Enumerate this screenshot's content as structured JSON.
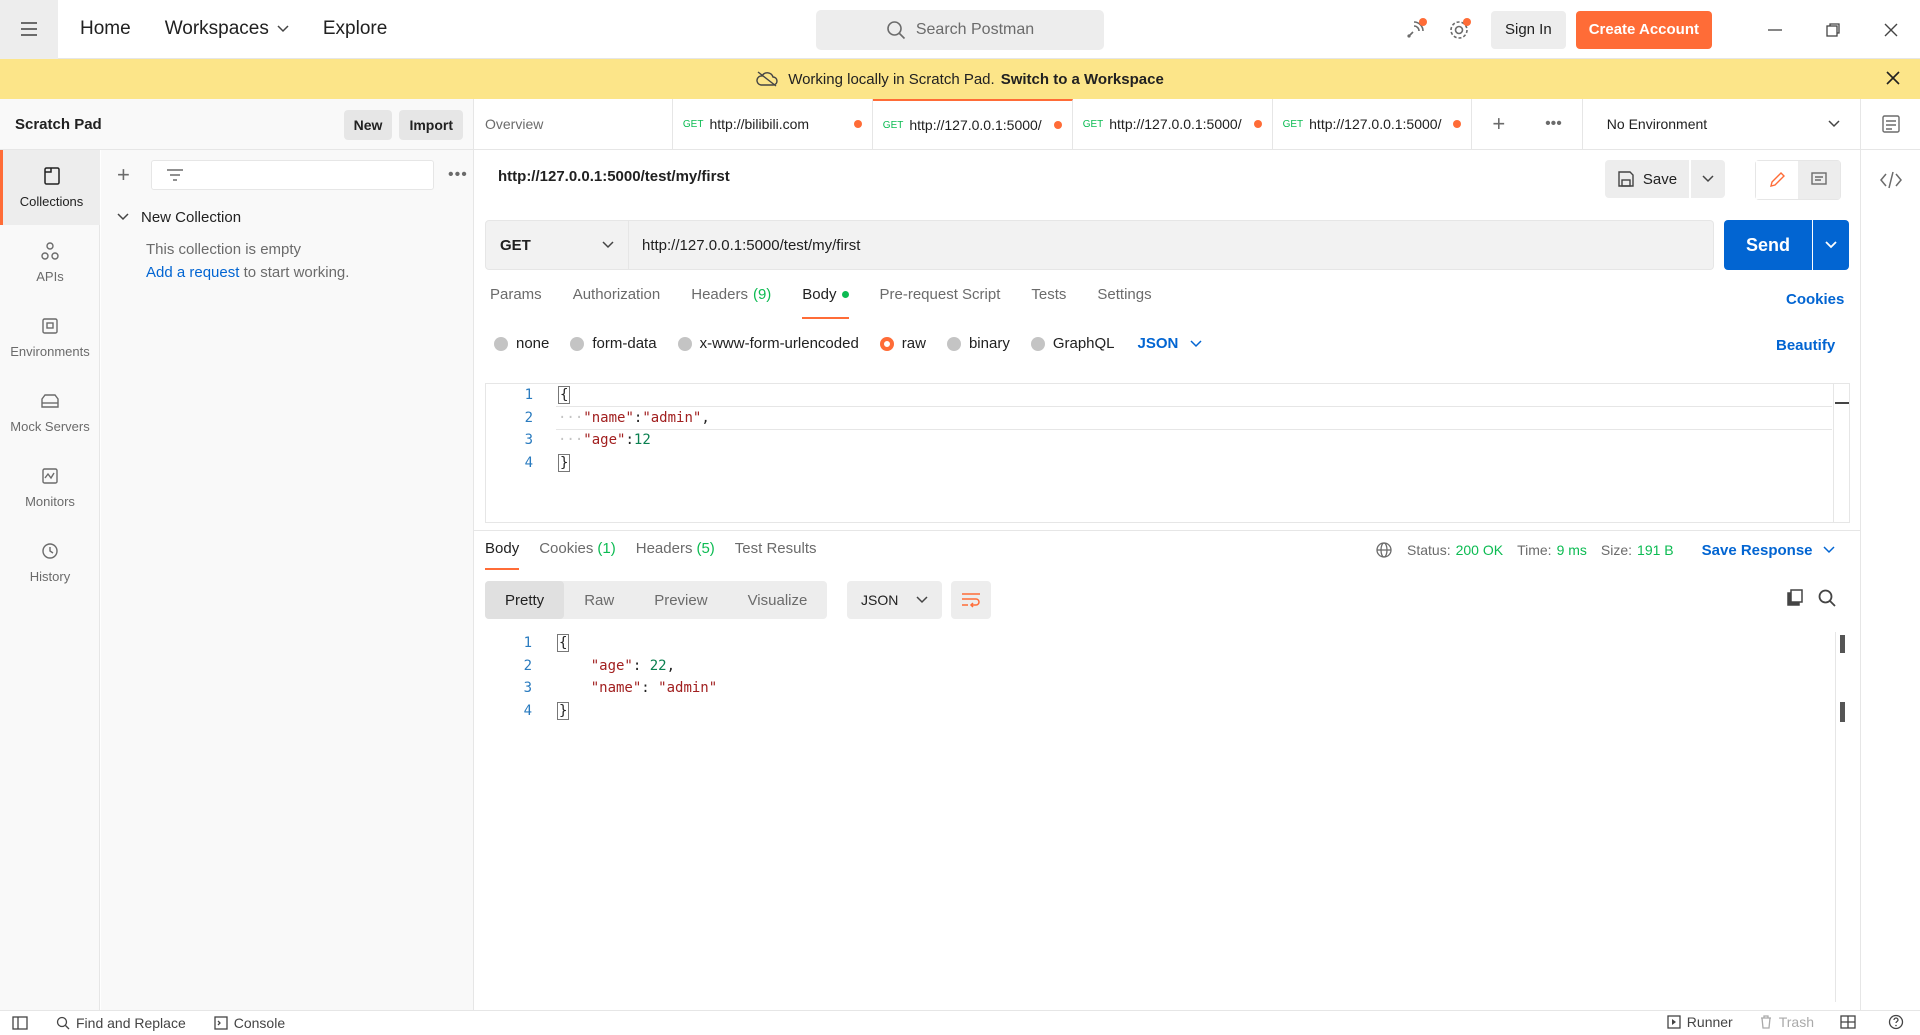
{
  "topbar": {
    "nav": [
      {
        "label": "Home"
      },
      {
        "label": "Workspaces"
      },
      {
        "label": "Explore"
      }
    ],
    "search_placeholder": "Search Postman",
    "sign_in": "Sign In",
    "create_account": "Create Account"
  },
  "banner": {
    "text": "Working locally in Scratch Pad.",
    "link": "Switch to a Workspace"
  },
  "scratchpad": {
    "title": "Scratch Pad",
    "new_label": "New",
    "import_label": "Import"
  },
  "rail": {
    "items": [
      {
        "label": "Collections",
        "icon": "collections-icon",
        "active": true
      },
      {
        "label": "APIs",
        "icon": "apis-icon"
      },
      {
        "label": "Environments",
        "icon": "environments-icon"
      },
      {
        "label": "Mock Servers",
        "icon": "mock-servers-icon"
      },
      {
        "label": "Monitors",
        "icon": "monitors-icon"
      },
      {
        "label": "History",
        "icon": "history-icon"
      }
    ]
  },
  "sidebar": {
    "collection_name": "New Collection",
    "empty_text": "This collection is empty",
    "add_link": "Add a request",
    "add_suffix": " to start working."
  },
  "tabs": {
    "overview": "Overview",
    "items": [
      {
        "method": "GET",
        "label": "http://bilibili.com"
      },
      {
        "method": "GET",
        "label": "http://127.0.0.1:5000/",
        "active": true
      },
      {
        "method": "GET",
        "label": "http://127.0.0.1:5000/"
      },
      {
        "method": "GET",
        "label": "http://127.0.0.1:5000/"
      }
    ],
    "environment": "No Environment"
  },
  "request": {
    "title": "http://127.0.0.1:5000/test/my/first",
    "save": "Save",
    "method": "GET",
    "url": "http://127.0.0.1:5000/test/my/first",
    "send": "Send",
    "tabs": {
      "params": "Params",
      "authorization": "Authorization",
      "headers": "Headers",
      "headers_count": "(9)",
      "body": "Body",
      "prerequest": "Pre-request Script",
      "tests": "Tests",
      "settings": "Settings"
    },
    "cookies": "Cookies",
    "body_types": {
      "none": "none",
      "form_data": "form-data",
      "urlencoded": "x-www-form-urlencoded",
      "raw": "raw",
      "binary": "binary",
      "graphql": "GraphQL",
      "json": "JSON"
    },
    "beautify": "Beautify",
    "body_lines": {
      "n1": "1",
      "n2": "2",
      "n3": "3",
      "n4": "4",
      "open": "{",
      "k_name": "\"name\"",
      "colon1": ":",
      "v_name": "\"admin\"",
      "comma1": ",",
      "k_age": "\"age\"",
      "colon2": ":",
      "v_age": "12",
      "close": "}"
    }
  },
  "response": {
    "tabs": {
      "body": "Body",
      "cookies": "Cookies",
      "cookies_count": "(1)",
      "headers": "Headers",
      "headers_count": "(5)",
      "tests": "Test Results"
    },
    "status_label": "Status:",
    "status_value": "200 OK",
    "time_label": "Time:",
    "time_value": "9 ms",
    "size_label": "Size:",
    "size_value": "191 B",
    "save_response": "Save Response",
    "views": {
      "pretty": "Pretty",
      "raw": "Raw",
      "preview": "Preview",
      "visualize": "Visualize"
    },
    "format": "JSON",
    "body_lines": {
      "n1": "1",
      "n2": "2",
      "n3": "3",
      "n4": "4",
      "open": "{",
      "k_age": "\"age\"",
      "colon1": ": ",
      "v_age": "22",
      "comma1": ",",
      "k_name": "\"name\"",
      "colon2": ": ",
      "v_name": "\"admin\"",
      "close": "}"
    }
  },
  "footer": {
    "find_replace": "Find and Replace",
    "console": "Console",
    "runner": "Runner",
    "trash": "Trash"
  },
  "colors": {
    "accent": "#ff6c37",
    "primary": "#0265d2",
    "success": "#0cbb52",
    "banner": "#fce589"
  }
}
